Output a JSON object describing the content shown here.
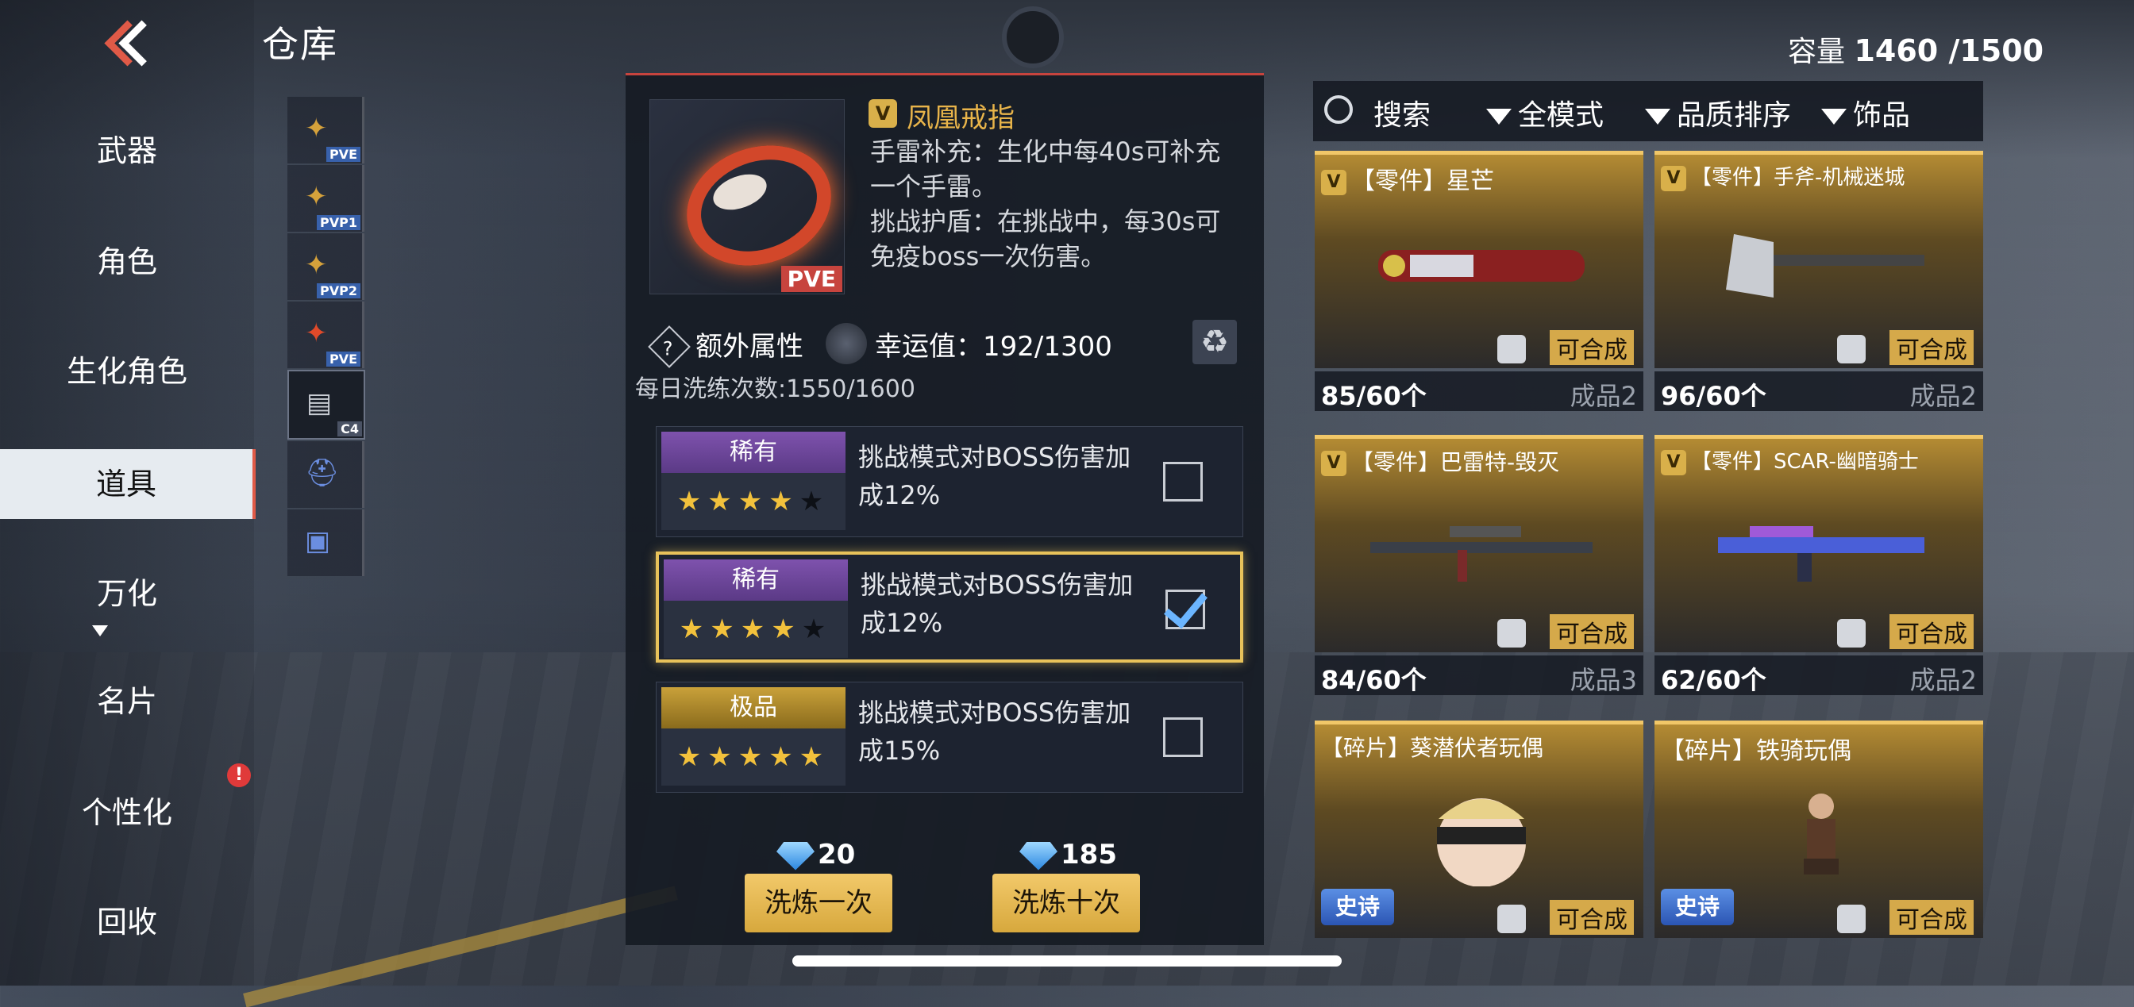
{
  "header": {
    "title": "仓库",
    "capacity_label": "容量",
    "capacity_value": "1460 /1500"
  },
  "sidebar": {
    "items": [
      {
        "label": "武器"
      },
      {
        "label": "角色"
      },
      {
        "label": "生化角色"
      },
      {
        "label": "道具"
      },
      {
        "label": "万化"
      },
      {
        "label": "名片"
      },
      {
        "label": "个性化"
      },
      {
        "label": "回收"
      }
    ],
    "active": "道具",
    "alert_badge": "!"
  },
  "thumbs": [
    {
      "tag": "PVE"
    },
    {
      "tag": "PVP1"
    },
    {
      "tag": "PVP2"
    },
    {
      "tag": "PVE"
    },
    {
      "tag": "C4"
    },
    {
      "tag": ""
    },
    {
      "tag": ""
    }
  ],
  "item": {
    "quality_icon": "V",
    "name": "凤凰戒指",
    "tag": "PVE",
    "desc1": "手雷补充：生化中每40s可补充一个手雷。",
    "desc2": "挑战护盾：在挑战中，每30s可免疫boss一次伤害。",
    "extra_label": "额外属性",
    "luck": "幸运值：192/1300",
    "daily": "每日洗练次数:1550/1600"
  },
  "attributes": [
    {
      "rarity": "稀有",
      "stars": "★★★★",
      "dim": "★",
      "text": "挑战模式对BOSS伤害加成12%",
      "checked": false
    },
    {
      "rarity": "稀有",
      "stars": "★★★★",
      "dim": "★",
      "text": "挑战模式对BOSS伤害加成12%",
      "checked": true
    },
    {
      "rarity": "极品",
      "stars": "★★★★★",
      "dim": "",
      "text": "挑战模式对BOSS伤害加成15%",
      "checked": false
    }
  ],
  "refine": {
    "once_cost": "20",
    "once_label": "洗炼一次",
    "ten_cost": "185",
    "ten_label": "洗炼十次"
  },
  "filters": {
    "search": "搜索",
    "mode": "全模式",
    "sort": "品质排序",
    "category": "饰品"
  },
  "cards": [
    {
      "title": "【零件】星芒",
      "has_q": true,
      "compose": "可合成",
      "count": "85/60个",
      "grade": "成品2"
    },
    {
      "title": "【零件】手斧-机械迷城",
      "has_q": true,
      "compose": "可合成",
      "count": "96/60个",
      "grade": "成品2"
    },
    {
      "title": "【零件】巴雷特-毁灭",
      "has_q": true,
      "compose": "可合成",
      "count": "84/60个",
      "grade": "成品3"
    },
    {
      "title": "【零件】SCAR-幽暗骑士",
      "has_q": true,
      "compose": "可合成",
      "count": "62/60个",
      "grade": "成品2"
    },
    {
      "title": "【碎片】葵潜伏者玩偶",
      "has_q": false,
      "compose": "可合成",
      "badge": "史诗"
    },
    {
      "title": "【碎片】铁骑玩偶",
      "has_q": false,
      "compose": "可合成",
      "badge": "史诗"
    }
  ],
  "colors": {
    "accent_red": "#e05a47",
    "gold": "#e8c25a",
    "rare_purple": "#7e52ad",
    "epic_gold": "#c9a13a"
  }
}
